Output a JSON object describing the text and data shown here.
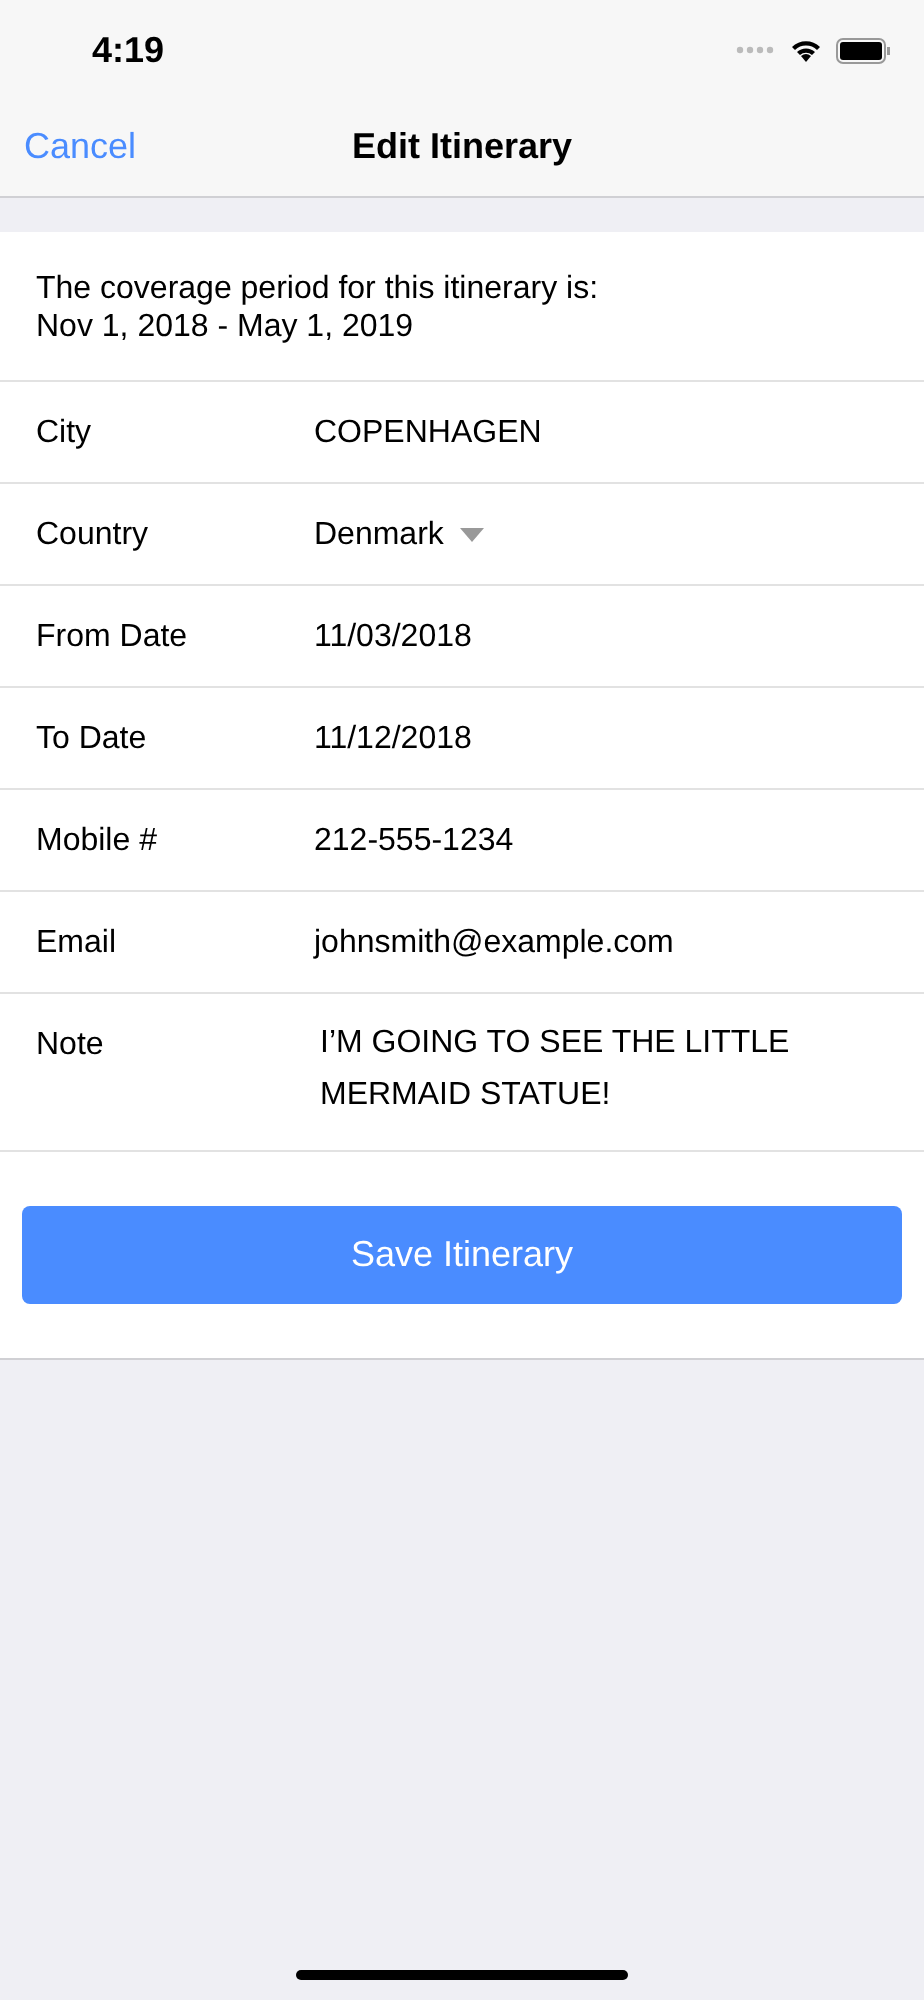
{
  "status_bar": {
    "time": "4:19"
  },
  "nav": {
    "cancel": "Cancel",
    "title": "Edit Itinerary"
  },
  "coverage": {
    "text": "The coverage period for this itinerary is:",
    "period": "Nov 1, 2018 - May 1, 2019"
  },
  "fields": [
    {
      "label": "City",
      "value": "COPENHAGEN",
      "kind": "text"
    },
    {
      "label": "Country",
      "value": "Denmark",
      "kind": "dropdown"
    },
    {
      "label": "From Date",
      "value": "11/03/2018",
      "kind": "text"
    },
    {
      "label": "To Date",
      "value": "11/12/2018",
      "kind": "text"
    },
    {
      "label": "Mobile #",
      "value": "212-555-1234",
      "kind": "text"
    },
    {
      "label": "Email",
      "value": "johnsmith@example.com",
      "kind": "text"
    },
    {
      "label": "Note",
      "value": "I’M GOING TO SEE THE LITTLE MERMAID STATUE!",
      "kind": "multiline"
    }
  ],
  "save_button": "Save Itinerary"
}
